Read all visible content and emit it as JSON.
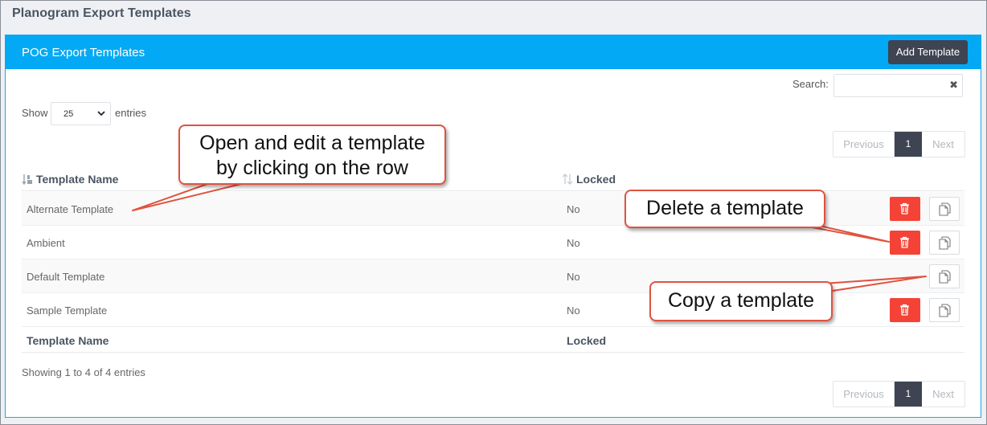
{
  "page": {
    "title": "Planogram Export Templates"
  },
  "panel": {
    "title": "POG Export Templates",
    "add_button": "Add Template"
  },
  "controls": {
    "search_label": "Search:",
    "search_value": "",
    "clear_glyph": "✖",
    "show_label": "Show",
    "entries_value": "25",
    "entries_label": "entries"
  },
  "pagination": {
    "previous": "Previous",
    "page": "1",
    "next": "Next"
  },
  "table": {
    "headers": {
      "name": "Template Name",
      "locked": "Locked"
    },
    "rows": [
      {
        "name": "Alternate Template",
        "locked": "No",
        "has_delete": true
      },
      {
        "name": "Ambient",
        "locked": "No",
        "has_delete": true
      },
      {
        "name": "Default Template",
        "locked": "No",
        "has_delete": false
      },
      {
        "name": "Sample Template",
        "locked": "No",
        "has_delete": true
      }
    ],
    "footer": {
      "name": "Template Name",
      "locked": "Locked"
    }
  },
  "info": "Showing 1 to 4 of 4 entries",
  "callouts": {
    "edit_line1": "Open and edit a template",
    "edit_line2": "by clicking on the row",
    "delete": "Delete a template",
    "copy": "Copy a template"
  },
  "icons": {
    "sort_name": "sort-alpha-down-icon",
    "sort_locked": "sort-icon",
    "delete": "trash-icon",
    "copy": "copy-icon",
    "select": "chevron-down-icon"
  },
  "colors": {
    "panel_header": "#03a9f4",
    "dark_button": "#3e4451",
    "delete_button": "#f44336",
    "callout_border": "#e0533f"
  }
}
